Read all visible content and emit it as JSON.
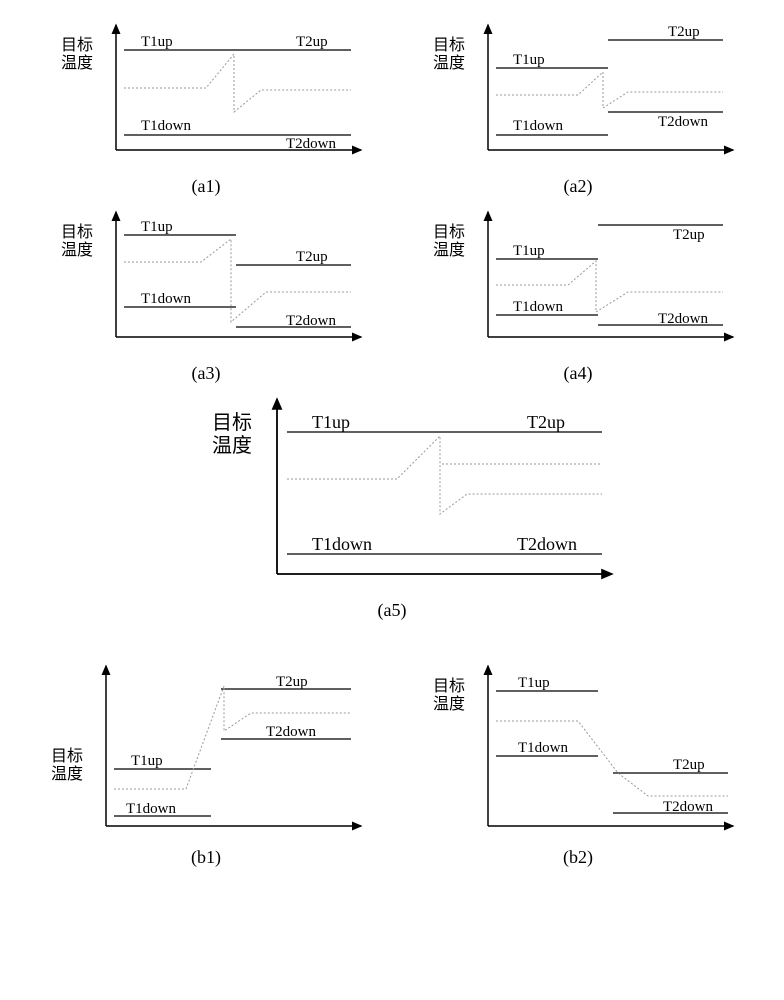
{
  "ylabel": "目标\n温度",
  "labels": {
    "t1up": "T1up",
    "t1down": "T1down",
    "t2up": "T2up",
    "t2down": "T2down"
  },
  "captions": {
    "a1": "(a1)",
    "a2": "(a2)",
    "a3": "(a3)",
    "a4": "(a4)",
    "a5": "(a5)",
    "b1": "(b1)",
    "b2": "(b2)"
  },
  "chart_data": [
    {
      "id": "a1",
      "type": "line",
      "xlabel": "",
      "ylabel": "目标温度",
      "series": [
        {
          "name": "T1up",
          "segment": 1,
          "y": 45
        },
        {
          "name": "T1down",
          "segment": 1,
          "y": 10
        },
        {
          "name": "T2up",
          "segment": 2,
          "y": 45
        },
        {
          "name": "T2down",
          "segment": 2,
          "y": 10
        },
        {
          "name": "trace",
          "points": [
            [
              0,
              28
            ],
            [
              40,
              28
            ],
            [
              55,
              44
            ],
            [
              55,
              18
            ],
            [
              70,
              28
            ],
            [
              100,
              28
            ]
          ]
        }
      ]
    },
    {
      "id": "a2",
      "type": "line",
      "series": [
        {
          "name": "T1up",
          "segment": 1,
          "y": 40
        },
        {
          "name": "T1down",
          "segment": 1,
          "y": 10
        },
        {
          "name": "T2up",
          "segment": 2,
          "y": 55
        },
        {
          "name": "T2down",
          "segment": 2,
          "y": 20
        },
        {
          "name": "trace",
          "points": [
            [
              0,
              28
            ],
            [
              40,
              28
            ],
            [
              55,
              38
            ],
            [
              55,
              22
            ],
            [
              70,
              30
            ],
            [
              100,
              30
            ]
          ]
        }
      ]
    },
    {
      "id": "a3",
      "type": "line",
      "series": [
        {
          "name": "T1up",
          "segment": 1,
          "y": 48
        },
        {
          "name": "T1down",
          "segment": 1,
          "y": 15
        },
        {
          "name": "T2up",
          "segment": 2,
          "y": 35
        },
        {
          "name": "T2down",
          "segment": 2,
          "y": 5
        },
        {
          "name": "trace",
          "points": [
            [
              0,
              35
            ],
            [
              40,
              35
            ],
            [
              55,
              46
            ],
            [
              55,
              8
            ],
            [
              75,
              20
            ],
            [
              100,
              20
            ]
          ]
        }
      ]
    },
    {
      "id": "a4",
      "type": "line",
      "series": [
        {
          "name": "T1up",
          "segment": 1,
          "y": 38
        },
        {
          "name": "T1down",
          "segment": 1,
          "y": 12
        },
        {
          "name": "T2up",
          "segment": 2,
          "y": 55
        },
        {
          "name": "T2down",
          "segment": 2,
          "y": 8
        },
        {
          "name": "trace",
          "points": [
            [
              0,
              26
            ],
            [
              40,
              26
            ],
            [
              50,
              38
            ],
            [
              50,
              12
            ],
            [
              70,
              22
            ],
            [
              100,
              22
            ]
          ]
        }
      ]
    },
    {
      "id": "a5",
      "type": "line",
      "series": [
        {
          "name": "T1up",
          "segment": 1,
          "y": 50
        },
        {
          "name": "T1down",
          "segment": 1,
          "y": 10
        },
        {
          "name": "T2up",
          "segment": 2,
          "y": 50
        },
        {
          "name": "T2down",
          "segment": 2,
          "y": 10
        },
        {
          "name": "trace",
          "points": [
            [
              0,
              33
            ],
            [
              40,
              33
            ],
            [
              55,
              49
            ],
            [
              55,
              20
            ],
            [
              68,
              28
            ],
            [
              100,
              28
            ]
          ]
        }
      ]
    },
    {
      "id": "b1",
      "type": "line",
      "series": [
        {
          "name": "T1up",
          "segment": 1,
          "y": 28
        },
        {
          "name": "T1down",
          "segment": 1,
          "y": 5
        },
        {
          "name": "T2up",
          "segment": 2,
          "y": 60
        },
        {
          "name": "T2down",
          "segment": 2,
          "y": 40
        },
        {
          "name": "trace",
          "points": [
            [
              0,
              20
            ],
            [
              35,
              20
            ],
            [
              55,
              60
            ],
            [
              55,
              42
            ],
            [
              70,
              48
            ],
            [
              100,
              48
            ]
          ]
        }
      ]
    },
    {
      "id": "b2",
      "type": "line",
      "series": [
        {
          "name": "T1up",
          "segment": 1,
          "y": 55
        },
        {
          "name": "T1down",
          "segment": 1,
          "y": 28
        },
        {
          "name": "T2up",
          "segment": 2,
          "y": 18
        },
        {
          "name": "T2down",
          "segment": 2,
          "y": 3
        },
        {
          "name": "trace",
          "points": [
            [
              0,
              40
            ],
            [
              40,
              40
            ],
            [
              58,
              18
            ],
            [
              72,
              10
            ],
            [
              100,
              10
            ]
          ]
        }
      ]
    }
  ]
}
